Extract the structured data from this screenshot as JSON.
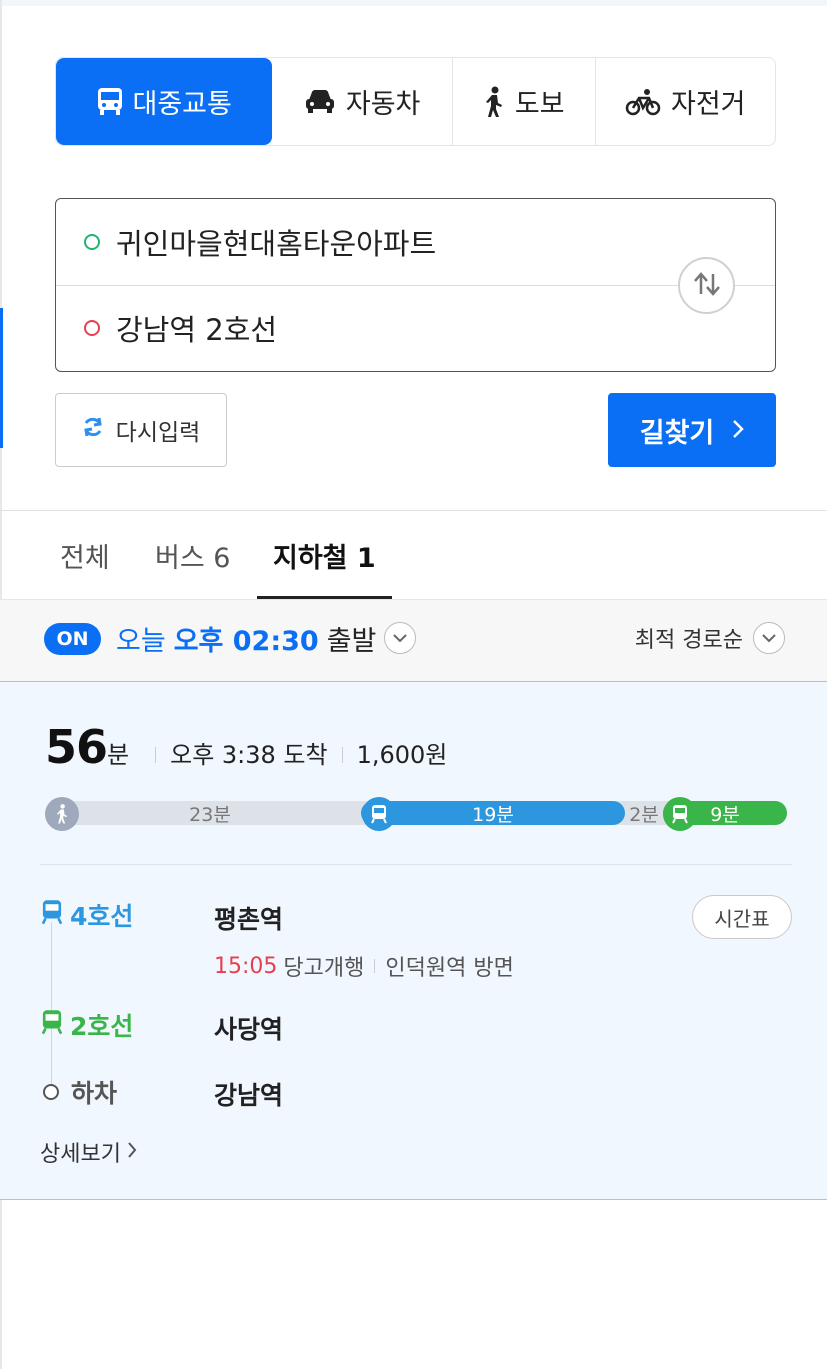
{
  "colors": {
    "accent": "#0a6ff5",
    "line4": "#2c97de",
    "line2": "#3ab54a",
    "walk": "#9ea9bb",
    "depart_time": "#e5404f"
  },
  "modes": [
    {
      "label": "대중교통",
      "icon": "bus-icon",
      "active": true
    },
    {
      "label": "자동차",
      "icon": "car-icon",
      "active": false
    },
    {
      "label": "도보",
      "icon": "walking-icon",
      "active": false
    },
    {
      "label": "자전거",
      "icon": "bicycle-icon",
      "active": false
    }
  ],
  "route": {
    "from": "귀인마을현대홈타운아파트",
    "to": "강남역 2호선",
    "reset_label": "다시입력",
    "search_label": "길찾기"
  },
  "result_tabs": [
    {
      "label": "전체",
      "active": false
    },
    {
      "label": "버스 6",
      "active": false
    },
    {
      "label": "지하철 1",
      "active": true
    }
  ],
  "time_filter": {
    "on_badge": "ON",
    "day": "오늘",
    "time": "오후 02:30",
    "suffix": "출발",
    "sort": "최적 경로순"
  },
  "result": {
    "minutes": "56",
    "minutes_unit": "분",
    "arrival": "오후 3:38 도착",
    "fare": "1,600원",
    "timeline": {
      "walk_label": "23분",
      "line4_label": "19분",
      "transfer_label": "2분",
      "line2_label": "9분",
      "walk_minutes": 23,
      "line4_minutes": 19,
      "transfer_minutes": 2,
      "line2_minutes": 9
    },
    "steps": [
      {
        "line": "4호선",
        "station": "평촌역",
        "depart_time": "15:05",
        "train": "당고개행",
        "direction": "인덕원역 방면"
      },
      {
        "line": "2호선",
        "station": "사당역"
      },
      {
        "line": "하차",
        "station": "강남역"
      }
    ],
    "timetable_label": "시간표",
    "detail_label": "상세보기"
  }
}
